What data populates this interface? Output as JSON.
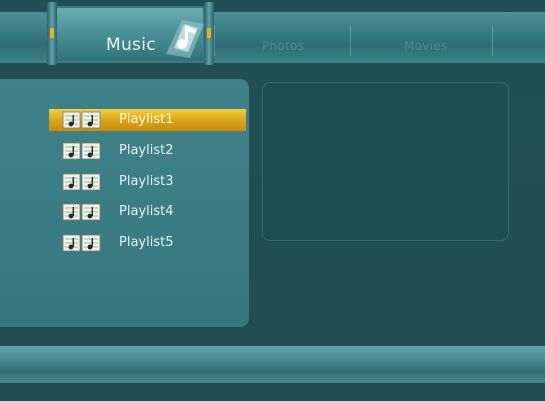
{
  "tabs": [
    {
      "label": "Music",
      "active": true
    },
    {
      "label": "Photos",
      "active": false
    },
    {
      "label": "Movies",
      "active": false
    }
  ],
  "playlists": [
    {
      "label": "Playlist1",
      "selected": true
    },
    {
      "label": "Playlist2",
      "selected": false
    },
    {
      "label": "Playlist3",
      "selected": false
    },
    {
      "label": "Playlist4",
      "selected": false
    },
    {
      "label": "Playlist5",
      "selected": false
    }
  ],
  "icons": {
    "tab_music": "music-notes-icon",
    "playlist": "playlist-notes-icon"
  },
  "colors": {
    "highlight": "#dca51a",
    "panel": "#3a7d83",
    "background": "#1f4a50",
    "text": "#e5f1f2"
  }
}
